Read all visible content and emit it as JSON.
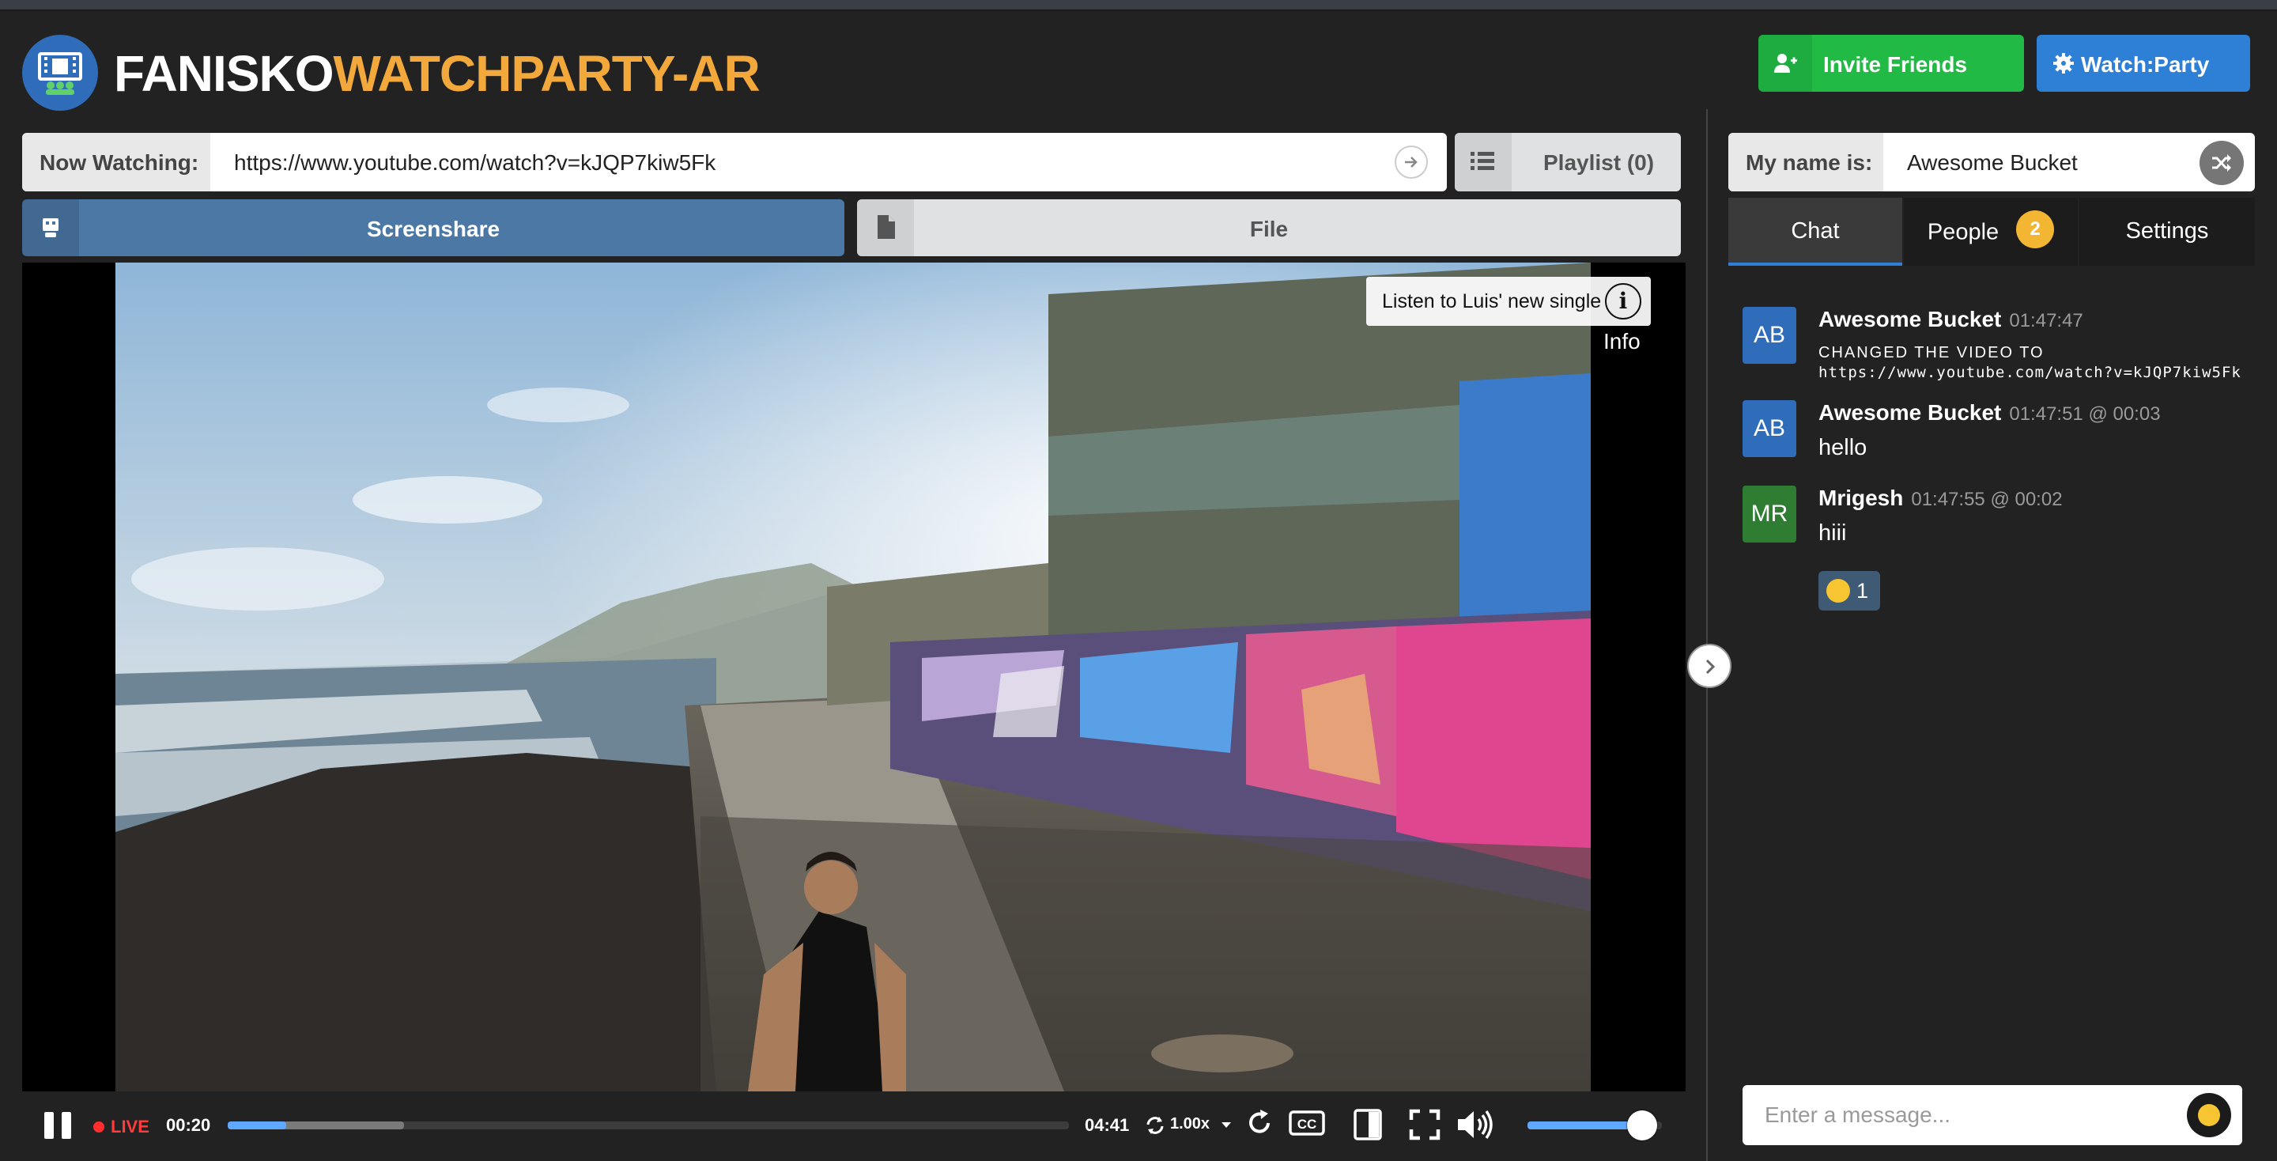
{
  "header": {
    "brand_white": "FANISKO",
    "brand_orange": "WATCHPARTY-AR",
    "invite_label": "Invite Friends",
    "party_label": "Watch:Party"
  },
  "now_watching": {
    "label": "Now Watching:",
    "url": "https://www.youtube.com/watch?v=kJQP7kiw5Fk",
    "playlist_label": "Playlist (0)"
  },
  "sources": {
    "screenshare_label": "Screenshare",
    "file_label": "File"
  },
  "video": {
    "info_card_text": "Listen to Luis' new single",
    "info_icon_glyph": "i",
    "info_label": "Info"
  },
  "controls": {
    "live_label": "LIVE",
    "current_time": "00:20",
    "duration": "04:41",
    "speed": "1.00x",
    "played_fraction": 0.07,
    "buffered_fraction": 0.21,
    "volume_fraction": 0.85
  },
  "sidebar": {
    "name_label": "My name is:",
    "name_value": "Awesome Bucket",
    "tabs": [
      {
        "label": "Chat",
        "active": true
      },
      {
        "label": "People",
        "badge": "2"
      },
      {
        "label": "Settings"
      }
    ],
    "messages": [
      {
        "initials": "AB",
        "author": "Awesome Bucket",
        "time": "01:47:47",
        "system_line1": "CHANGED THE VIDEO TO",
        "system_line2": "https://www.youtube.com/watch?v=kJQP7kiw5Fk",
        "avatar_color": "#2f6dbb"
      },
      {
        "initials": "AB",
        "author": "Awesome Bucket",
        "time": "01:47:51 @ 00:03",
        "text": "hello",
        "avatar_color": "#2f6dbb"
      },
      {
        "initials": "MR",
        "author": "Mrigesh",
        "time": "01:47:55 @ 00:02",
        "text": "hiii",
        "avatar_color": "#2e7d32",
        "reaction_count": "1"
      }
    ],
    "input_placeholder": "Enter a message..."
  },
  "colors": {
    "background": "#222222",
    "brand_orange": "#f2a83b",
    "invite_green": "#21ba45",
    "party_blue": "#2e7fd6",
    "accent_blue": "#5fa8ff",
    "badge_yellow": "#f2b632"
  },
  "icons": [
    "film-logo-icon",
    "add-user-icon",
    "gear-icon",
    "arrow-right-icon",
    "list-icon",
    "screenshare-icon",
    "file-icon",
    "info-icon",
    "pause-icon",
    "live-dot-icon",
    "speed-icon",
    "replay-icon",
    "closed-captions-icon",
    "theater-mode-icon",
    "fullscreen-icon",
    "volume-icon",
    "chevron-right-icon",
    "shuffle-icon",
    "emoji-icon"
  ]
}
